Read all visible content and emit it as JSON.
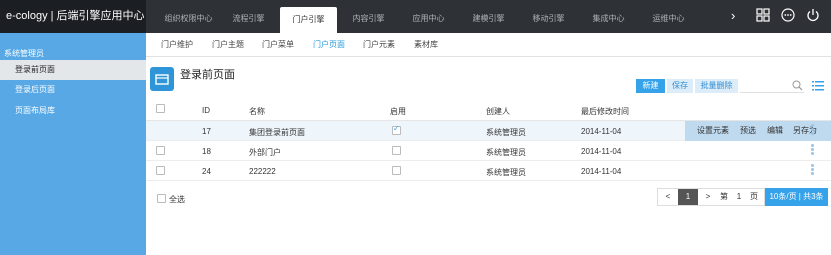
{
  "app": {
    "brand": "e-cology | 后端引擎应用中心"
  },
  "top_tabs": [
    {
      "label": "组织权限中心"
    },
    {
      "label": "流程引擎"
    },
    {
      "label": "门户引擎"
    },
    {
      "label": "内容引擎"
    },
    {
      "label": "应用中心"
    },
    {
      "label": "建模引擎"
    },
    {
      "label": "移动引擎"
    },
    {
      "label": "集成中心"
    },
    {
      "label": "运维中心"
    }
  ],
  "sidebar": {
    "title": "系统管理员",
    "items": [
      {
        "label": "登录前页面"
      },
      {
        "label": "登录后页面"
      },
      {
        "label": "页面布局库"
      }
    ]
  },
  "sub_tabs": [
    {
      "label": "门户维护"
    },
    {
      "label": "门户主题"
    },
    {
      "label": "门户菜单"
    },
    {
      "label": "门户页面"
    },
    {
      "label": "门户元素"
    },
    {
      "label": "素材库"
    }
  ],
  "page": {
    "title": "登录前页面"
  },
  "toolbar": {
    "new_label": "新建",
    "save_label": "保存",
    "batch_delete_label": "批量删除"
  },
  "table": {
    "headers": {
      "id": "ID",
      "name": "名称",
      "enabled": "启用",
      "creator": "创建人",
      "modified": "最后修改时间"
    },
    "rows": [
      {
        "id": "17",
        "name": "集团登录前页面",
        "enabled": true,
        "creator": "系统管理员",
        "modified": "2014-11-04"
      },
      {
        "id": "18",
        "name": "外部门户",
        "enabled": false,
        "creator": "系统管理员",
        "modified": "2014-11-04"
      },
      {
        "id": "24",
        "name": "222222",
        "enabled": false,
        "creator": "系统管理员",
        "modified": "2014-11-04"
      }
    ],
    "row_actions": {
      "settings": "设置元素",
      "preview": "预选",
      "edit": "编辑",
      "save_as": "另存为"
    }
  },
  "footer": {
    "select_all": "全选"
  },
  "pager": {
    "prev": "<",
    "current": "1",
    "next": ">",
    "goto_prefix": "第",
    "goto_value": "1",
    "goto_suffix": "页",
    "summary": "10条/页 | 共3条"
  },
  "colors": {
    "accent": "#36a2e9",
    "sidebar": "#57a8e5",
    "topbar": "#2e3237"
  }
}
